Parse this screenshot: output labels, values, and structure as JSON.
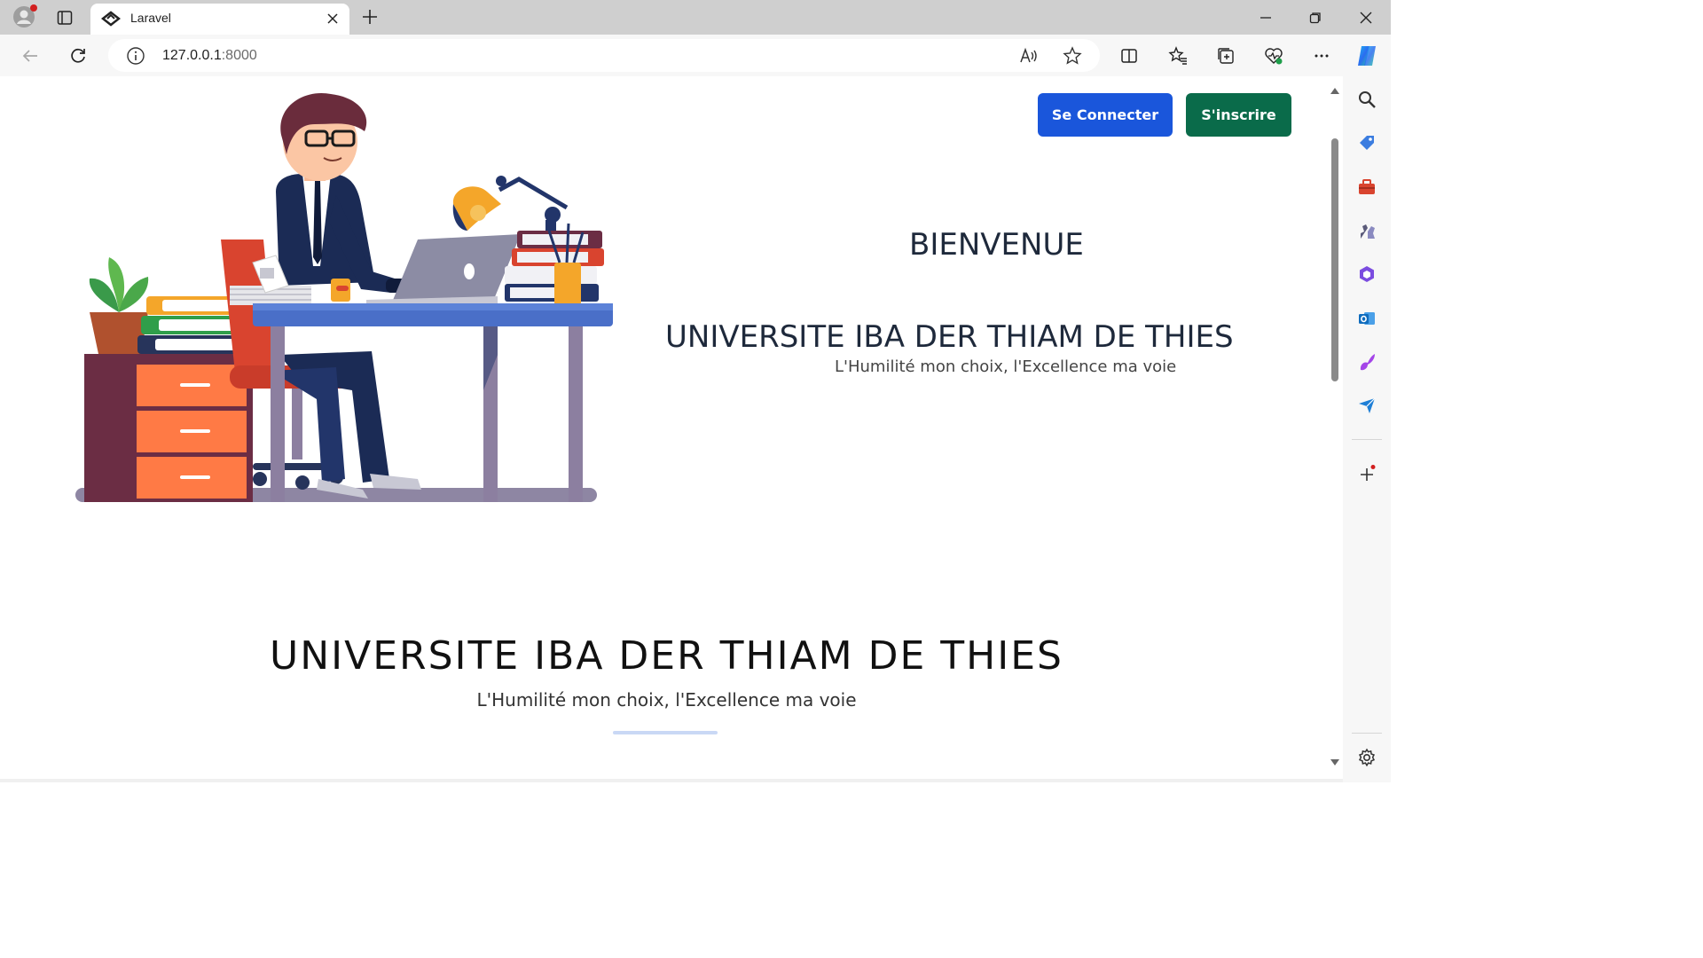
{
  "browser": {
    "tab": {
      "title": "Laravel"
    },
    "address": {
      "host": "127.0.0.1",
      "port": ":8000"
    }
  },
  "page": {
    "nav": {
      "login_label": "Se Connecter",
      "signup_label": "S'inscrire"
    },
    "hero": {
      "welcome": "BIENVENUE",
      "title": "UNIVERSITE IBA DER THIAM DE THIES",
      "motto": "L'Humilité mon choix, l'Excellence ma voie"
    },
    "section": {
      "title": "UNIVERSITE IBA DER THIAM DE THIES",
      "motto": "L'Humilité mon choix, l'Excellence ma voie"
    }
  },
  "colors": {
    "login_button": "#1a56db",
    "signup_button": "#0a6b4a"
  },
  "icons": {
    "toolbar": [
      "back-icon",
      "refresh-icon",
      "info-icon",
      "read-aloud-icon",
      "favorite-star-icon",
      "split-screen-icon",
      "favorites-icon",
      "collections-icon",
      "browser-essentials-icon",
      "more-icon",
      "copilot-icon"
    ],
    "sidebar": [
      "search-icon",
      "shopping-tag-icon",
      "tools-icon",
      "games-icon",
      "microsoft-365-icon",
      "outlook-icon",
      "designer-icon",
      "send-icon",
      "add-icon",
      "settings-icon"
    ]
  }
}
